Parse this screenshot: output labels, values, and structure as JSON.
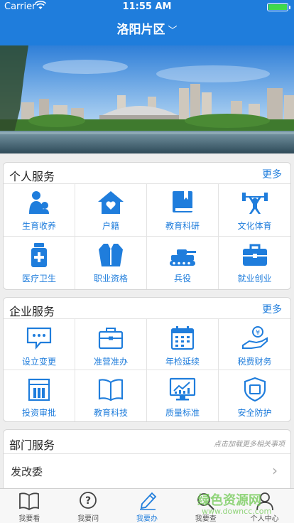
{
  "status_bar": {
    "carrier": "Carrier",
    "time": "11:55 AM"
  },
  "nav": {
    "title": "洛阳片区"
  },
  "personal": {
    "title": "个人服务",
    "more": "更多",
    "items": [
      {
        "label": "生育收养",
        "icon": "person-baby-icon"
      },
      {
        "label": "户籍",
        "icon": "house-heart-icon"
      },
      {
        "label": "教育科研",
        "icon": "book-icon"
      },
      {
        "label": "文化体育",
        "icon": "weightlifter-icon"
      },
      {
        "label": "医疗卫生",
        "icon": "medicine-bottle-icon"
      },
      {
        "label": "职业资格",
        "icon": "suit-icon"
      },
      {
        "label": "兵役",
        "icon": "tank-icon"
      },
      {
        "label": "就业创业",
        "icon": "briefcase-icon"
      }
    ]
  },
  "enterprise": {
    "title": "企业服务",
    "more": "更多",
    "items": [
      {
        "label": "设立变更",
        "icon": "chat-bubble-icon"
      },
      {
        "label": "准营准办",
        "icon": "briefcase-outline-icon"
      },
      {
        "label": "年检延续",
        "icon": "calendar-icon"
      },
      {
        "label": "税费财务",
        "icon": "money-hand-icon"
      },
      {
        "label": "投资审批",
        "icon": "building-icon"
      },
      {
        "label": "教育科技",
        "icon": "open-book-icon"
      },
      {
        "label": "质量标准",
        "icon": "monitor-chart-icon"
      },
      {
        "label": "安全防护",
        "icon": "shield-icon"
      }
    ]
  },
  "department": {
    "title": "部门服务",
    "hint": "点击加载更多相关事项",
    "rows": [
      {
        "name": "发改委"
      }
    ]
  },
  "tabs": [
    {
      "label": "我要看",
      "icon": "book-outline-icon",
      "active": false
    },
    {
      "label": "我要问",
      "icon": "question-bubble-icon",
      "active": false
    },
    {
      "label": "我要办",
      "icon": "pencil-icon",
      "active": true
    },
    {
      "label": "我要查",
      "icon": "magnifier-icon",
      "active": false
    },
    {
      "label": "个人中心",
      "icon": "user-icon",
      "active": false
    }
  ],
  "watermark": {
    "text": "绿色资源网",
    "url": "www.downcc.com"
  },
  "colors": {
    "primary": "#1f7ddc",
    "background": "#eeeeee",
    "battery": "#3fd94b"
  }
}
